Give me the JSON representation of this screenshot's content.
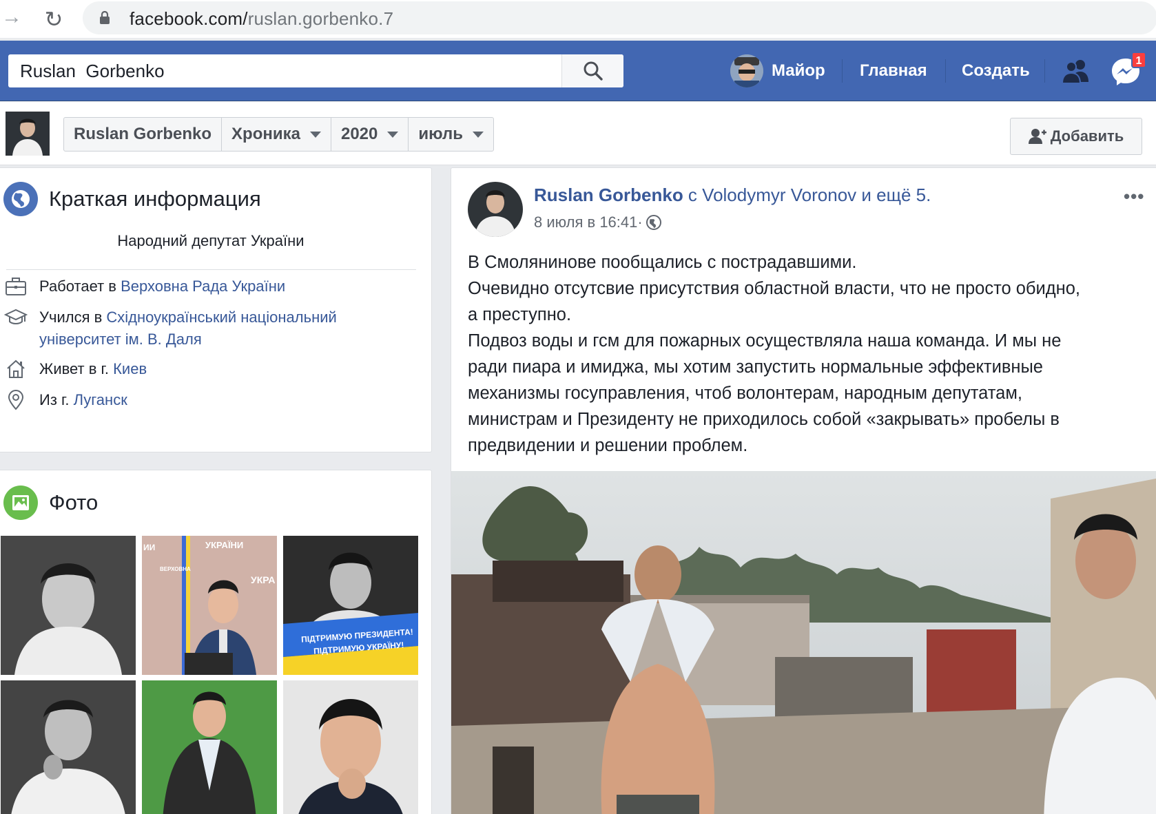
{
  "browser": {
    "url_host": "facebook.com/",
    "url_path": "ruslan.gorbenko.7"
  },
  "header": {
    "search_value": "Ruslan  Gorbenko",
    "user_name": "Майор",
    "home_label": "Главная",
    "create_label": "Создать",
    "messages_badge": "1"
  },
  "subheader": {
    "crumbs": [
      {
        "label": "Ruslan Gorbenko"
      },
      {
        "label": "Хроника"
      },
      {
        "label": "2020"
      },
      {
        "label": "июль"
      }
    ],
    "add_friend_label": "Добавить"
  },
  "intro": {
    "title": "Краткая информация",
    "bio": "Народний депутат України",
    "work_prefix": "Работает в ",
    "work_link": "Верховна Рада України",
    "study_prefix": "Учился в ",
    "study_link_line1": "Східноукраїнський національний",
    "study_link_line2": "університет ім. В. Даля",
    "lives_prefix": "Живет в г. ",
    "lives_link": "Киев",
    "from_prefix": "Из г. ",
    "from_link": "Луганск"
  },
  "photos": {
    "title": "Фото",
    "banner_line1": "ПІДТРИМУЮ ПРЕЗИДЕНТА!",
    "banner_line2": "ПІДТРИМУЮ УКРАЇНУ!",
    "podium_sign1": "УКРАЇНИ",
    "podium_sign2": "ВЕРХОВНА",
    "podium_sign3": "УКРА",
    "podium_sign4": "ИИ"
  },
  "post": {
    "author": "Ruslan Gorbenko",
    "with_text": " с ",
    "tagged": "Volodymyr Voronov",
    "and_more": " и ещё 5.",
    "timestamp": "8 июля в 16:41",
    "dot": " · ",
    "more": "•••",
    "lines": [
      "В Смолянинове пообщались с пострадавшими.",
      "Очевидно отсутсвие присутствия областной власти, что не просто обидно,",
      "а преступно.",
      "Подвоз воды и гсм для пожарных осуществляла наша команда. И мы не",
      "ради пиара и имиджа, мы хотим запустить нормальные эффективные",
      "механизмы госуправления, чтоб волонтерам, народным депутатам,",
      "министрам и Президенту не приходилось собой «закрывать» пробелы в",
      "предвидении и решении проблем."
    ]
  }
}
